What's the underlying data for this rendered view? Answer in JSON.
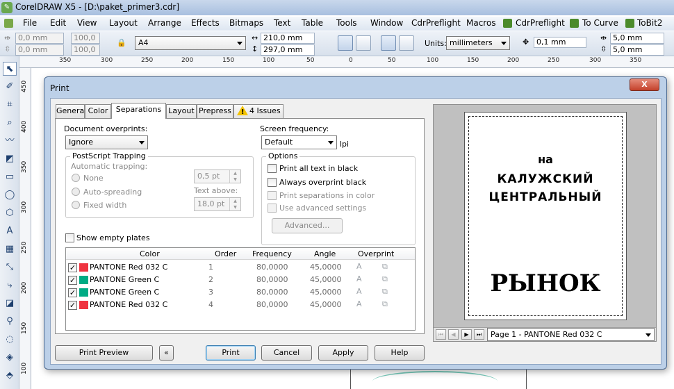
{
  "app": {
    "title": "CorelDRAW X5 - [D:\\paket_primer3.cdr]"
  },
  "menu": [
    "File",
    "Edit",
    "View",
    "Layout",
    "Arrange",
    "Effects",
    "Bitmaps",
    "Text",
    "Table",
    "Tools",
    "Window",
    "CdrPreflight",
    "Macros",
    "CdrPreflight",
    "To Curve",
    "ToBit2"
  ],
  "propbar": {
    "x": "0,0 mm",
    "y": "0,0 mm",
    "scale_x": "100,0",
    "scale_y": "100,0",
    "paper": "A4",
    "width": "210,0 mm",
    "height": "297,0 mm",
    "units_label": "Units:",
    "units": "millimeters",
    "nudge": "0,1 mm",
    "dup_x": "5,0 mm",
    "dup_y": "5,0 mm"
  },
  "ruler": {
    "h_ticks": [
      "350",
      "300",
      "250",
      "200",
      "150",
      "100",
      "50",
      "0",
      "50",
      "100",
      "150",
      "200",
      "250",
      "300",
      "350"
    ],
    "v_ticks": [
      "450",
      "400",
      "350",
      "300",
      "250",
      "200",
      "150",
      "100"
    ]
  },
  "dialog": {
    "title": "Print",
    "close": "X",
    "tabs": [
      "General",
      "Color",
      "Separations",
      "Layout",
      "Prepress",
      "4 Issues"
    ],
    "active_tab": "Separations",
    "document_overprints_label": "Document overprints:",
    "document_overprints_value": "Ignore",
    "screen_frequency_label": "Screen frequency:",
    "screen_frequency_value": "Default",
    "lpi": "lpi",
    "trapping": {
      "title": "PostScript Trapping",
      "automatic": "Automatic trapping:",
      "none": "None",
      "auto_spreading": "Auto-spreading",
      "fixed_width": "Fixed width",
      "value1": "0,5 pt",
      "text_above": "Text above:",
      "value2": "18,0 pt"
    },
    "options": {
      "title": "Options",
      "print_all_text_black": "Print all text in black",
      "always_overprint_black": "Always overprint black",
      "print_separations_color": "Print separations in color",
      "use_advanced": "Use advanced settings",
      "advanced_button": "Advanced..."
    },
    "show_empty_plates": "Show empty plates",
    "plates": {
      "headers": [
        "Color",
        "Order",
        "Frequency",
        "Angle",
        "Overprint"
      ],
      "rows": [
        {
          "name": "PANTONE Red 032 C",
          "order": "1",
          "frequency": "80,0000",
          "angle": "45,0000",
          "swatch": "#ef3340"
        },
        {
          "name": "PANTONE Green C",
          "order": "2",
          "frequency": "80,0000",
          "angle": "45,0000",
          "swatch": "#00ab84"
        },
        {
          "name": "PANTONE Green C",
          "order": "3",
          "frequency": "80,0000",
          "angle": "45,0000",
          "swatch": "#00ab84"
        },
        {
          "name": "PANTONE Red 032 C",
          "order": "4",
          "frequency": "80,0000",
          "angle": "45,0000",
          "swatch": "#ef3340"
        }
      ]
    },
    "preview": {
      "line1": "на",
      "line2": "КАЛУЖСКИЙ",
      "line3": "ЦЕНТРАЛЬНЫЙ",
      "line4": "РЫНОК",
      "page_select": "Page 1 - PANTONE Red 032 C"
    },
    "buttons": {
      "print_preview": "Print Preview",
      "collapse": "«",
      "print": "Print",
      "cancel": "Cancel",
      "apply": "Apply",
      "help": "Help"
    }
  }
}
